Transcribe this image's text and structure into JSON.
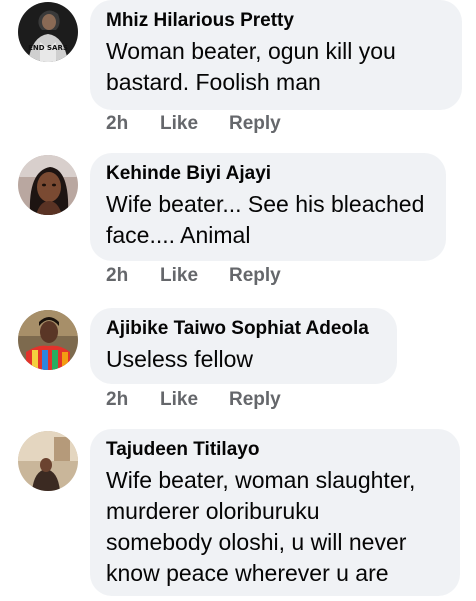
{
  "comments": [
    {
      "author": "Mhiz Hilarious Pretty",
      "text": "Woman beater, ogun kill you bastard.  Foolish man",
      "avatar_caption": "END SARS",
      "time": "2h",
      "like_label": "Like",
      "reply_label": "Reply"
    },
    {
      "author": "Kehinde Biyi Ajayi",
      "text": "Wife beater... See his bleached face.... Animal",
      "time": "2h",
      "like_label": "Like",
      "reply_label": "Reply"
    },
    {
      "author": "Ajibike Taiwo Sophiat Adeola",
      "text": "Useless fellow",
      "time": "2h",
      "like_label": "Like",
      "reply_label": "Reply"
    },
    {
      "author": "Tajudeen Titilayo",
      "text": "Wife beater, woman slaughter, murderer oloriburuku somebody oloshi, u will never know peace wherever u are"
    }
  ],
  "colors": {
    "bubble": "#f0f2f5",
    "name": "#050505",
    "meta": "#65676b"
  }
}
